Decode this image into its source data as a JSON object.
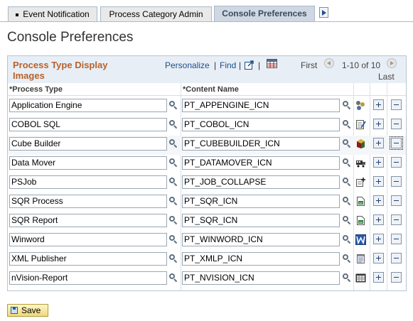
{
  "tabs": [
    {
      "label": "Event Notification",
      "active": false
    },
    {
      "label": "Process Category Admin",
      "active": false
    },
    {
      "label": "Console Preferences",
      "active": true
    }
  ],
  "page_title": "Console Preferences",
  "grid": {
    "title": "Process Type Display Images",
    "personalize": "Personalize",
    "pipe": "|",
    "find": "Find",
    "first": "First",
    "range": "1-10 of 10",
    "last": "Last",
    "col_process_type": "*Process Type",
    "col_content_name": "*Content Name"
  },
  "rows": [
    {
      "process_type": "Application Engine",
      "content_name": "PT_APPENGINE_ICN",
      "icon": "appengine-icon"
    },
    {
      "process_type": "COBOL SQL",
      "content_name": "PT_COBOL_ICN",
      "icon": "cobol-icon"
    },
    {
      "process_type": "Cube Builder",
      "content_name": "PT_CUBEBUILDER_ICN",
      "icon": "cube-icon"
    },
    {
      "process_type": "Data Mover",
      "content_name": "PT_DATAMOVER_ICN",
      "icon": "truck-icon"
    },
    {
      "process_type": "PSJob",
      "content_name": "PT_JOB_COLLAPSE",
      "icon": "job-icon"
    },
    {
      "process_type": "SQR Process",
      "content_name": "PT_SQR_ICN",
      "icon": "sqr-icon"
    },
    {
      "process_type": "SQR Report",
      "content_name": "PT_SQR_ICN",
      "icon": "sqr-icon"
    },
    {
      "process_type": "Winword",
      "content_name": "PT_WINWORD_ICN",
      "icon": "word-icon"
    },
    {
      "process_type": "XML Publisher",
      "content_name": "PT_XMLP_ICN",
      "icon": "xmlp-icon"
    },
    {
      "process_type": "nVision-Report",
      "content_name": "PT_NVISION_ICN",
      "icon": "nvision-icon"
    }
  ],
  "save_label": "Save",
  "colors": {
    "accent": "#b7612b",
    "link": "#1d4e89",
    "header_bg": "#e8eef5"
  }
}
